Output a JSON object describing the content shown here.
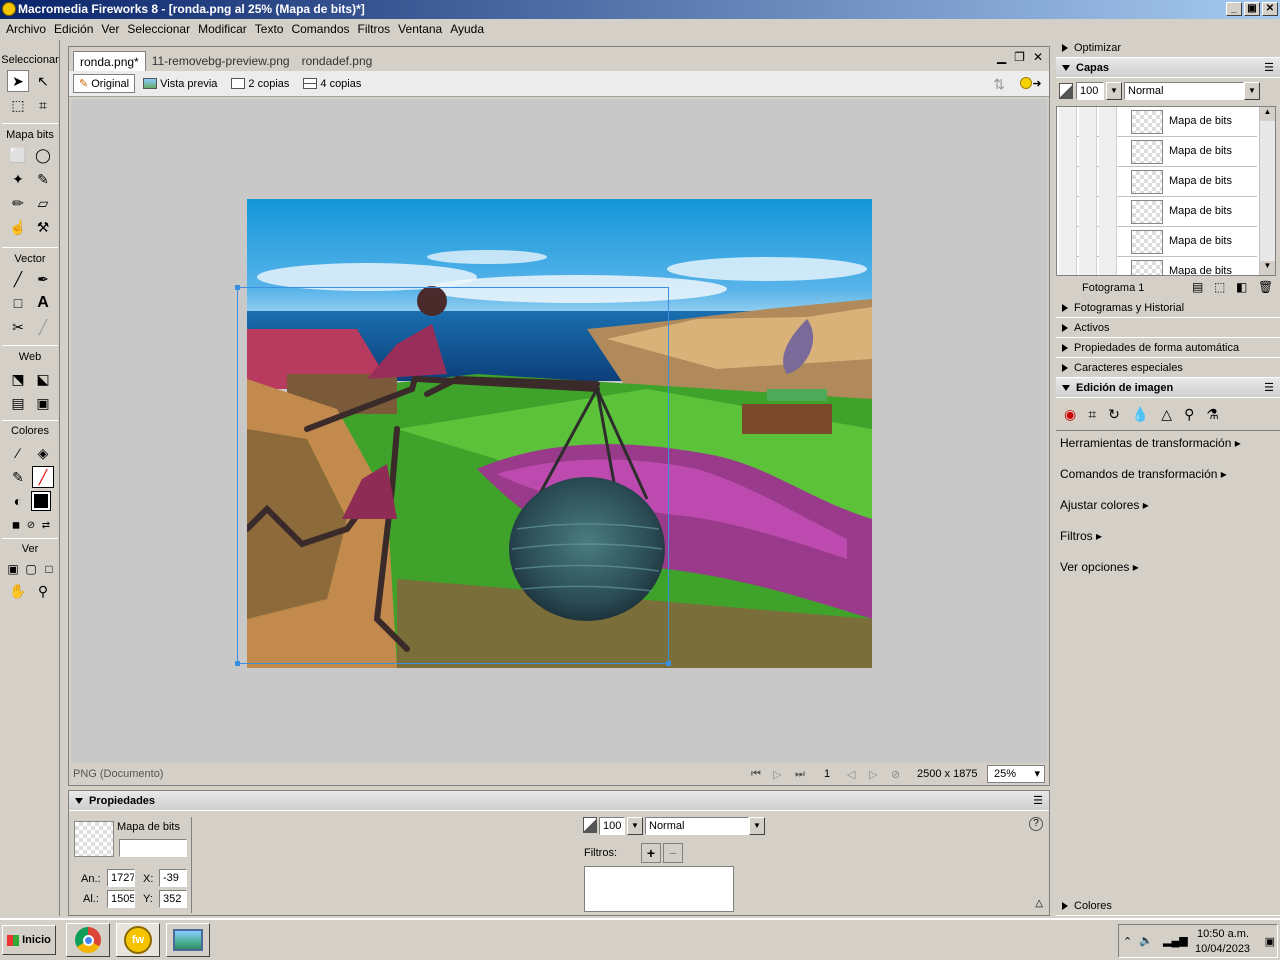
{
  "window": {
    "title": "Macromedia Fireworks 8 - [ronda.png al  25% (Mapa de bits)*]",
    "min": "_",
    "max": "▣",
    "close": "✕"
  },
  "menu": [
    "Archivo",
    "Edición",
    "Ver",
    "Seleccionar",
    "Modificar",
    "Texto",
    "Comandos",
    "Filtros",
    "Ventana",
    "Ayuda"
  ],
  "toolbox": {
    "sections": [
      "Seleccionar",
      "Mapa bits",
      "Vector",
      "Web",
      "Colores",
      "Ver"
    ]
  },
  "document": {
    "tabs": [
      "ronda.png*",
      "11-removebg-preview.png",
      "rondadef.png"
    ],
    "views": [
      "Original",
      "Vista previa",
      "2 copias",
      "4 copias"
    ],
    "status": {
      "type": "PNG (Documento)",
      "frame": "1",
      "size": "2500 x 1875",
      "zoom": "25%"
    }
  },
  "properties": {
    "title": "Propiedades",
    "object_type": "Mapa de bits",
    "name_value": "",
    "w_label": "An.:",
    "w_value": "1727",
    "h_label": "Al.:",
    "h_value": "1505",
    "x_label": "X:",
    "x_value": "-39",
    "y_label": "Y:",
    "y_value": "352",
    "opacity": "100",
    "blend": "Normal",
    "filters_label": "Filtros:",
    "help": "?"
  },
  "right_panels": {
    "optimizar": "Optimizar",
    "capas": "Capas",
    "layer_opacity": "100",
    "layer_blend": "Normal",
    "layers": [
      "Mapa de bits",
      "Mapa de bits",
      "Mapa de bits",
      "Mapa de bits",
      "Mapa de bits",
      "Mapa de bits"
    ],
    "frame": "Fotograma 1",
    "collapsed": [
      "Fotogramas y Historial",
      "Activos",
      "Propiedades de forma automática",
      "Caracteres especiales"
    ],
    "edicion": "Edición de imagen",
    "edicion_items": [
      "Herramientas de transformación",
      "Comandos de transformación",
      "Ajustar colores",
      "Filtros",
      "Ver opciones"
    ],
    "colores": "Colores"
  },
  "taskbar": {
    "start": "Inicio",
    "time": "10:50 a.m.",
    "date": "10/04/2023"
  }
}
